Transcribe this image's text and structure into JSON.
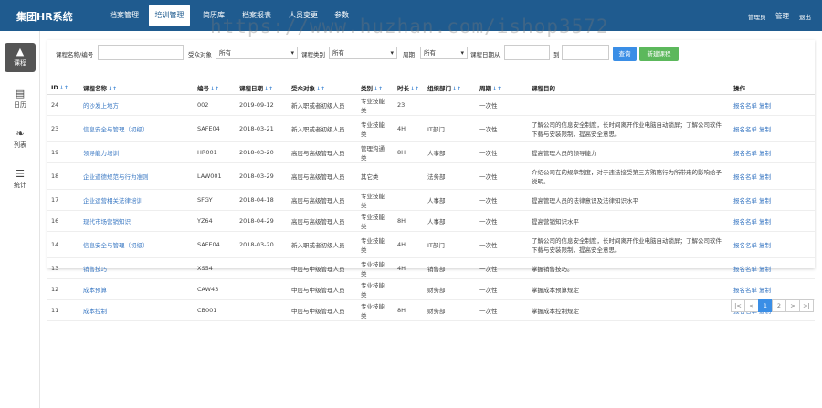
{
  "header": {
    "brand": "集团HR系统",
    "nav": [
      "档案管理",
      "培训管理",
      "简历库",
      "档案报表",
      "人员变更",
      "参数"
    ],
    "right": [
      "管理员",
      "管理",
      "退出"
    ]
  },
  "watermark": "https://www.huzhan.com/ishop3572",
  "sidebar": [
    {
      "label": "课程",
      "icon": "tree-icon"
    },
    {
      "label": "日历",
      "icon": "calendar-icon"
    },
    {
      "label": "列表",
      "icon": "leaf-icon"
    },
    {
      "label": "统计",
      "icon": "list-icon"
    }
  ],
  "filters": {
    "name_label": "课程名称/编号",
    "name_value": "",
    "audience_label": "受众对象",
    "audience_value": "所有",
    "category_label": "课程类别",
    "category_value": "所有",
    "cycle_label": "周期",
    "cycle_value": "所有",
    "date_label": "课程日期从",
    "date_from": "",
    "date_to_label": "到",
    "date_to": "",
    "search_btn": "查询",
    "new_btn": "新建课程"
  },
  "table": {
    "columns": [
      "ID",
      "课程名称",
      "编号",
      "课程日期",
      "受众对象",
      "类别",
      "时长",
      "组织部门",
      "周期",
      "课程目的",
      "操作"
    ],
    "sortable": [
      true,
      true,
      true,
      true,
      true,
      true,
      true,
      true,
      true,
      false,
      false
    ],
    "rows": [
      {
        "id": "24",
        "name": "的沙发上地方",
        "code": "002",
        "date": "2019-09-12",
        "audience": "新入职或者初级人员",
        "category": "专业技能类",
        "duration": "23",
        "dept": "",
        "cycle": "一次性",
        "purpose": "",
        "ops": [
          "报名名单",
          "复制"
        ]
      },
      {
        "id": "23",
        "name": "信息安全与管理（初级）",
        "code": "SAFE04",
        "date": "2018-03-21",
        "audience": "新入职或者初级人员",
        "category": "专业技能类",
        "duration": "4H",
        "dept": "IT部门",
        "cycle": "一次性",
        "purpose": "了解公司的信息安全制度，长时间离开作业电脑自动锁屏；了解公司软件下载与安装限制，提高安全意思。",
        "ops": [
          "报名名单",
          "复制"
        ]
      },
      {
        "id": "19",
        "name": "领导能力培训",
        "code": "HR001",
        "date": "2018-03-20",
        "audience": "高层与高级管理人员",
        "category": "管理沟通类",
        "duration": "8H",
        "dept": "人事部",
        "cycle": "一次性",
        "purpose": "提高管理人员的领导能力",
        "ops": [
          "报名名单",
          "复制"
        ]
      },
      {
        "id": "18",
        "name": "企业道德规范与行为准则",
        "code": "LAW001",
        "date": "2018-03-29",
        "audience": "高层与高级管理人员",
        "category": "其它类",
        "duration": "",
        "dept": "法务部",
        "cycle": "一次性",
        "purpose": "介绍公司在的规章制度，对于违法接受第三方贿赂行为所带来的影响给予说明。",
        "ops": [
          "报名名单",
          "复制"
        ]
      },
      {
        "id": "17",
        "name": "企业运营相关法律培训",
        "code": "SFGY",
        "date": "2018-04-18",
        "audience": "高层与高级管理人员",
        "category": "专业技能类",
        "duration": "",
        "dept": "人事部",
        "cycle": "一次性",
        "purpose": "提高管理人员的法律意识及法律知识水平",
        "ops": [
          "报名名单",
          "复制"
        ]
      },
      {
        "id": "16",
        "name": "现代市场营销知识",
        "code": "YZ64",
        "date": "2018-04-29",
        "audience": "高层与高级管理人员",
        "category": "专业技能类",
        "duration": "8H",
        "dept": "人事部",
        "cycle": "一次性",
        "purpose": "提高营销知识水平",
        "ops": [
          "报名名单",
          "复制"
        ]
      },
      {
        "id": "14",
        "name": "信息安全与管理（初级）",
        "code": "SAFE04",
        "date": "2018-03-20",
        "audience": "新入职或者初级人员",
        "category": "专业技能类",
        "duration": "4H",
        "dept": "IT部门",
        "cycle": "一次性",
        "purpose": "了解公司的信息安全制度，长时间离开作业电脑自动锁屏；了解公司软件下载与安装限制，提高安全意思。",
        "ops": [
          "报名名单",
          "复制"
        ]
      },
      {
        "id": "13",
        "name": "销售技巧",
        "code": "XS54",
        "date": "",
        "audience": "中层与中级管理人员",
        "category": "专业技能类",
        "duration": "4H",
        "dept": "销售部",
        "cycle": "一次性",
        "purpose": "掌握销售技巧。",
        "ops": [
          "报名名单",
          "复制"
        ]
      },
      {
        "id": "12",
        "name": "成本预算",
        "code": "CAW43",
        "date": "",
        "audience": "中层与中级管理人员",
        "category": "专业技能类",
        "duration": "",
        "dept": "财务部",
        "cycle": "一次性",
        "purpose": "掌握成本预算规定",
        "ops": [
          "报名名单",
          "复制"
        ]
      },
      {
        "id": "11",
        "name": "成本控制",
        "code": "CB001",
        "date": "",
        "audience": "中层与中级管理人员",
        "category": "专业技能类",
        "duration": "8H",
        "dept": "财务部",
        "cycle": "一次性",
        "purpose": "掌握成本控制规定",
        "ops": [
          "报名名单",
          "复制"
        ]
      }
    ]
  },
  "pagination": [
    "|<",
    "<",
    "1",
    "2",
    ">",
    ">|"
  ],
  "pagination_active": "1"
}
